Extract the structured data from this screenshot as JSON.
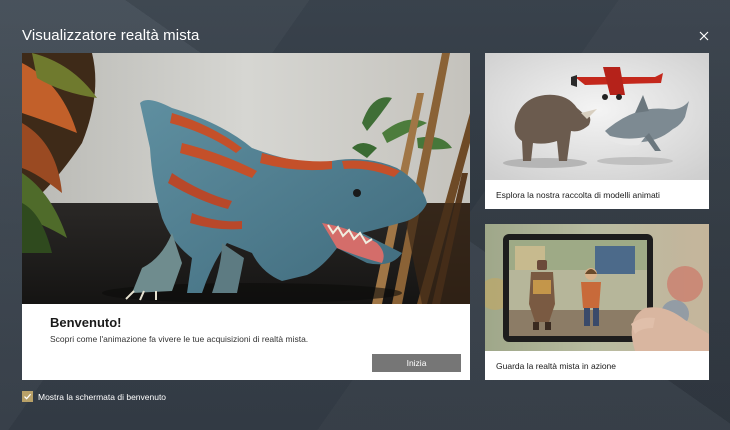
{
  "window": {
    "title": "Visualizzatore realtà mista",
    "close_icon": "close-icon"
  },
  "welcome_card": {
    "heading": "Benvenuto!",
    "description": "Scopri come l'animazione fa vivere le tue acquisizioni di realtà mista.",
    "start_button": "Inizia",
    "image": "dinosaur-photo"
  },
  "side_cards": [
    {
      "label": "Esplora la nostra raccolta di modelli animati",
      "image": "animal-models-photo"
    },
    {
      "label": "Guarda la realtà mista in azione",
      "image": "tablet-classroom-photo"
    }
  ],
  "footer": {
    "show_welcome_label": "Mostra la schermata di benvenuto",
    "show_welcome_checked": true
  },
  "colors": {
    "background": "#3a4450",
    "accent_checkbox": "#b9a168",
    "button": "#767676"
  }
}
